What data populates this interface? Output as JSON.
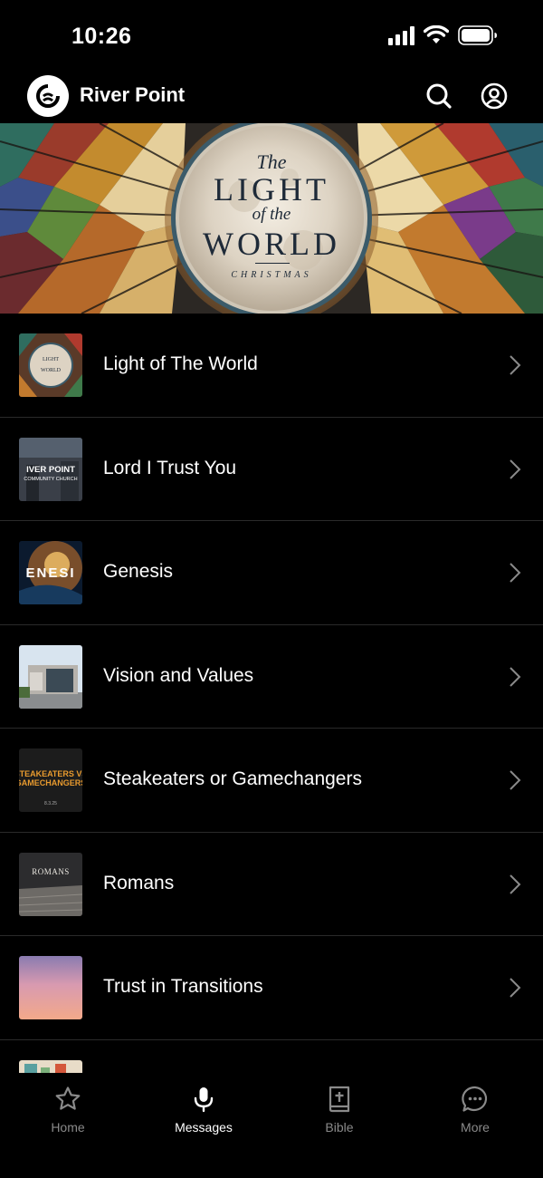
{
  "status_bar": {
    "time": "10:26"
  },
  "header": {
    "title": "River Point",
    "logo_icon": "river-point-logo-icon",
    "search_icon": "search-icon",
    "account_icon": "account-icon"
  },
  "hero": {
    "the": "The",
    "light": "LIGHT",
    "of_the": "of the",
    "world": "WORLD",
    "christmas": "CHRISTMAS"
  },
  "series": [
    {
      "label": "Light of The World",
      "thumb_text": "The LIGHT of the WORLD"
    },
    {
      "label": "Lord I Trust You",
      "thumb_text": "IVER POINT COMMUNITY CHURCH"
    },
    {
      "label": "Genesis",
      "thumb_text": "ENESI"
    },
    {
      "label": "Vision and Values",
      "thumb_text": ""
    },
    {
      "label": "Steakeaters or Gamechangers",
      "thumb_text": "STEAKEATERS VS GAMECHANGERS",
      "thumb_date": "8.3.25"
    },
    {
      "label": "Romans",
      "thumb_text": "ROMANS"
    },
    {
      "label": "Trust in Transitions",
      "thumb_text": ""
    },
    {
      "label": "",
      "thumb_text": ""
    }
  ],
  "tabs": [
    {
      "label": "Home",
      "icon": "star-icon",
      "active": false
    },
    {
      "label": "Messages",
      "icon": "microphone-icon",
      "active": true
    },
    {
      "label": "Bible",
      "icon": "bible-icon",
      "active": false
    },
    {
      "label": "More",
      "icon": "chat-bubble-icon",
      "active": false
    }
  ],
  "colors": {
    "background": "#000000",
    "text": "#ffffff",
    "inactive_tab": "#8a8a8a",
    "divider": "#2a2a2a"
  }
}
